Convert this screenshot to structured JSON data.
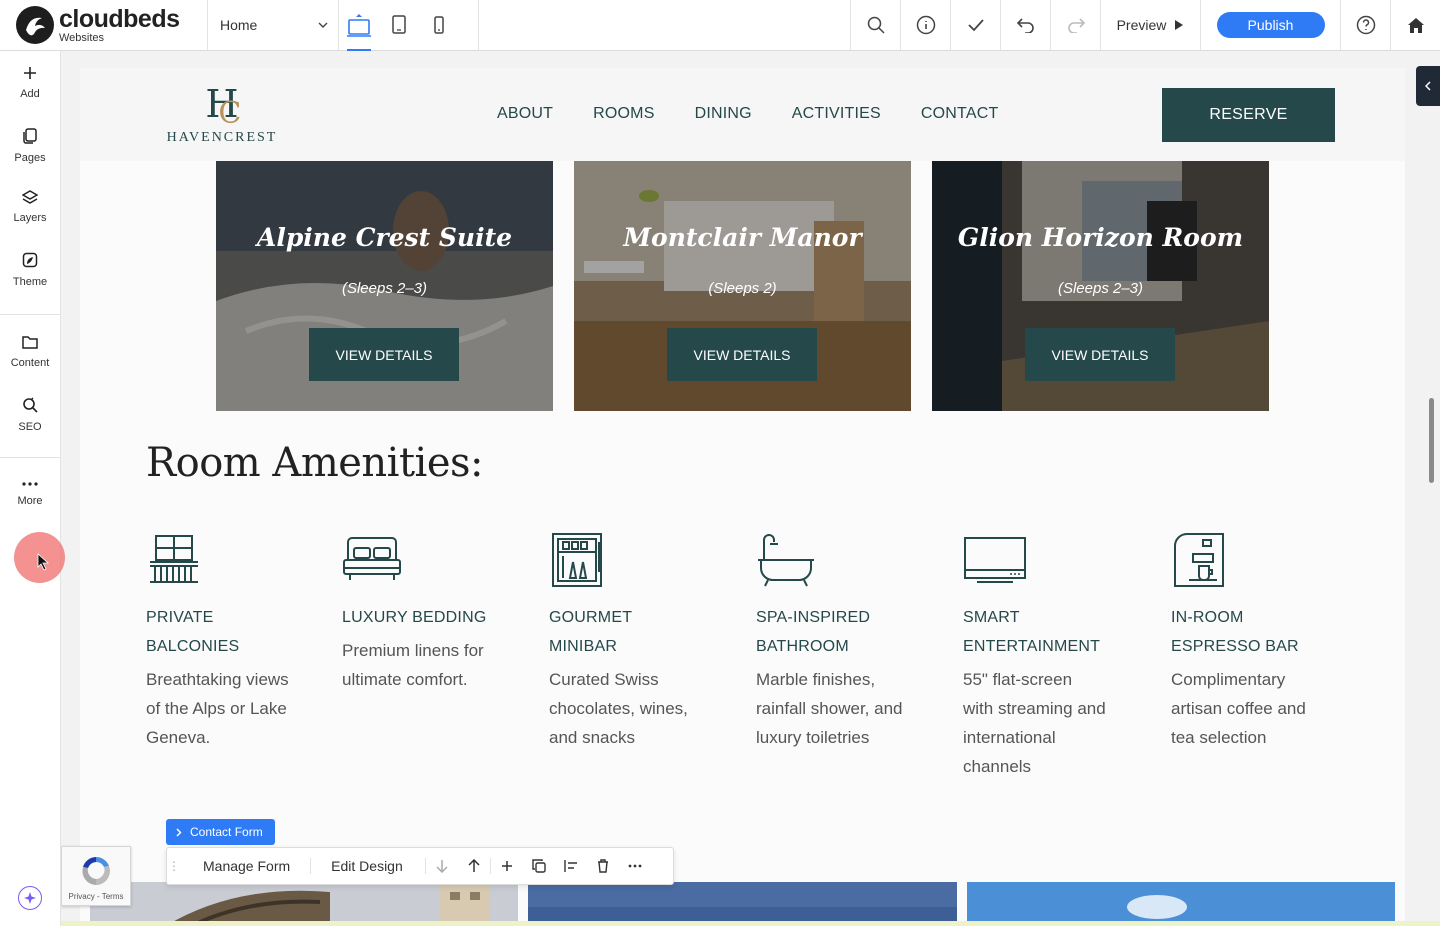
{
  "app": {
    "brand_name": "cloudbeds",
    "brand_sub": "Websites"
  },
  "toolbar": {
    "page_selected": "Home",
    "preview_label": "Preview",
    "publish_label": "Publish"
  },
  "sidebar": {
    "items": [
      {
        "label": "Add",
        "icon": "plus-icon"
      },
      {
        "label": "Pages",
        "icon": "pages-icon"
      },
      {
        "label": "Layers",
        "icon": "layers-icon"
      },
      {
        "label": "Theme",
        "icon": "theme-icon"
      },
      {
        "label": "Content",
        "icon": "folder-icon"
      },
      {
        "label": "SEO",
        "icon": "seo-icon"
      },
      {
        "label": "More",
        "icon": "more-icon"
      }
    ]
  },
  "site": {
    "logo_mono": "H",
    "logo_mono_c": "C",
    "logo_word": "HAVENCREST",
    "nav": [
      "ABOUT",
      "ROOMS",
      "DINING",
      "ACTIVITIES",
      "CONTACT"
    ],
    "reserve_label": "RESERVE",
    "rooms": [
      {
        "title": "Alpine Crest Suite",
        "sleeps": "(Sleeps 2–3)",
        "button": "VIEW DETAILS"
      },
      {
        "title": "Montclair Manor",
        "sleeps": "(Sleeps 2)",
        "button": "VIEW DETAILS"
      },
      {
        "title": "Glion Horizon Room",
        "sleeps": "(Sleeps 2–3)",
        "button": "VIEW DETAILS"
      }
    ],
    "amenities_title": "Room Amenities:",
    "amenities": [
      {
        "name_l1": "PRIVATE",
        "name_l2": "BALCONIES",
        "desc": [
          "Breathtaking views",
          "of the Alps or Lake",
          "Geneva."
        ]
      },
      {
        "name_l1": "LUXURY BEDDING",
        "name_l2": "",
        "desc": [
          "Premium linens for",
          "ultimate comfort."
        ]
      },
      {
        "name_l1": "GOURMET",
        "name_l2": "MINIBAR",
        "desc": [
          "Curated Swiss",
          "chocolates, wines,",
          "and snacks"
        ]
      },
      {
        "name_l1": "SPA-INSPIRED",
        "name_l2": "BATHROOM",
        "desc": [
          "Marble finishes,",
          "rainfall shower, and",
          "luxury toiletries"
        ]
      },
      {
        "name_l1": "SMART",
        "name_l2": "ENTERTAINMENT",
        "desc": [
          "55\" flat-screen",
          "with streaming and",
          "international",
          "channels"
        ]
      },
      {
        "name_l1": "IN-ROOM",
        "name_l2": "ESPRESSO BAR",
        "desc": [
          "Complimentary",
          "artisan coffee and",
          "tea selection"
        ]
      }
    ]
  },
  "contact_form": {
    "badge_label": "Contact Form",
    "manage_label": "Manage Form",
    "edit_label": "Edit Design"
  },
  "recaptcha": {
    "text": "Privacy - Terms"
  },
  "colors": {
    "accent": "#2f7bf5",
    "brand_teal": "#25494b",
    "gold": "#b8925e"
  }
}
